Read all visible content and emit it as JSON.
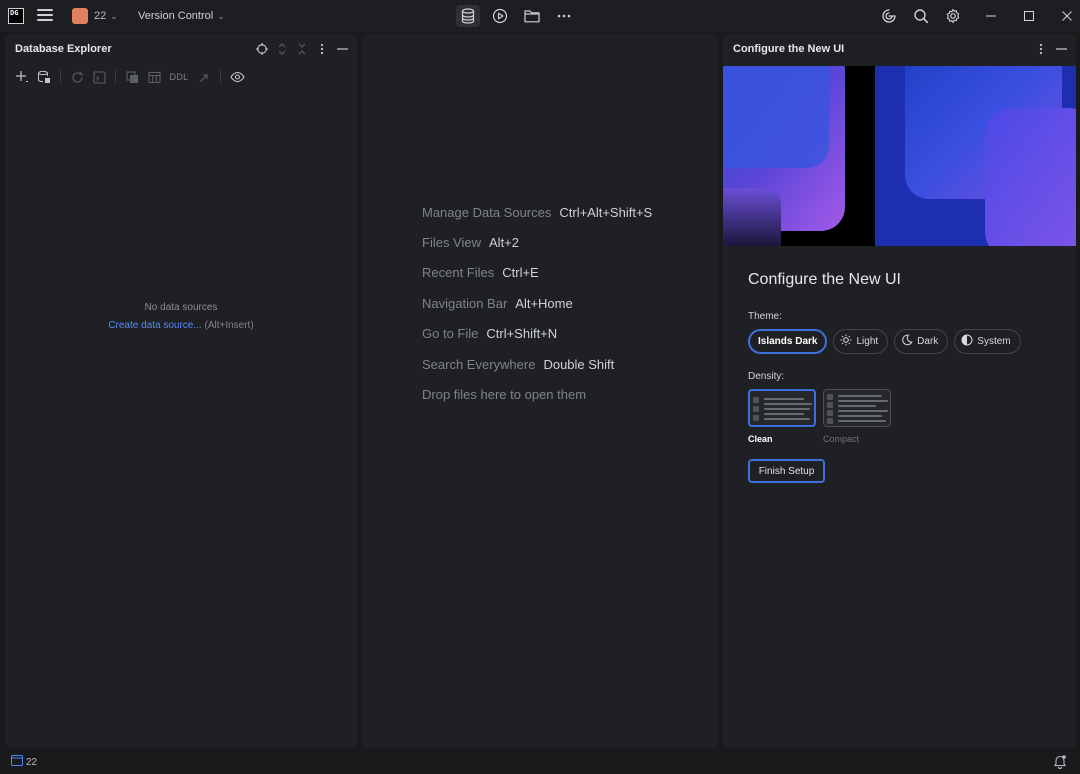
{
  "titlebar": {
    "logo_text": "DG",
    "project": {
      "name": "22"
    },
    "vcs": {
      "label": "Version Control"
    },
    "center_tools": [
      "database-icon",
      "run-icon",
      "folder-icon",
      "more-horizontal-icon"
    ],
    "right_tools": [
      "ai-assistant-icon",
      "search-icon",
      "settings-icon"
    ],
    "window_controls": [
      "minimize-icon",
      "maximize-icon",
      "close-icon"
    ]
  },
  "db_explorer": {
    "title": "Database Explorer",
    "toolbar_ddl": "DDL",
    "empty_message": "No data sources",
    "create_link": "Create data source...",
    "create_shortcut": "(Alt+Insert)"
  },
  "hints": [
    {
      "label": "Manage Data Sources",
      "key": "Ctrl+Alt+Shift+S"
    },
    {
      "label": "Files View",
      "key": "Alt+2"
    },
    {
      "label": "Recent Files",
      "key": "Ctrl+E"
    },
    {
      "label": "Navigation Bar",
      "key": "Alt+Home"
    },
    {
      "label": "Go to File",
      "key": "Ctrl+Shift+N"
    },
    {
      "label": "Search Everywhere",
      "key": "Double Shift"
    },
    {
      "label": "Drop files here to open them",
      "key": ""
    }
  ],
  "configure": {
    "panel_title": "Configure the New UI",
    "heading": "Configure the New UI",
    "theme_label": "Theme:",
    "themes": [
      "Islands Dark",
      "Light",
      "Dark",
      "System"
    ],
    "selected_theme": "Islands Dark",
    "density_label": "Density:",
    "densities": [
      "Clean",
      "Compact"
    ],
    "selected_density": "Clean",
    "finish_label": "Finish Setup"
  },
  "statusbar": {
    "project": "22"
  },
  "colors": {
    "accent": "#3e6fdb",
    "link": "#548af7",
    "project_badge": "#e0805c"
  }
}
